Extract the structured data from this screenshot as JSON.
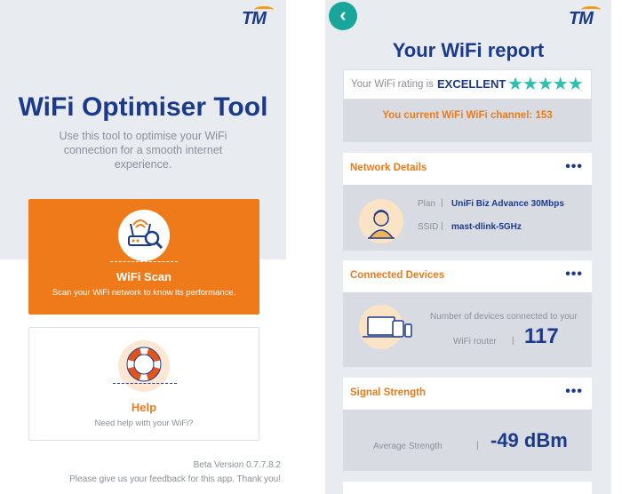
{
  "left_screen": {
    "brand": "TM",
    "title": "WiFi Optimiser Tool",
    "subtitle": "Use this tool to optimise your WiFi connection for a smooth internet experience.",
    "scan_card": {
      "title": "WiFi Scan",
      "description": "Scan your WiFi network to know its performance.",
      "icon": "router-search-icon",
      "color": "#ef7a1a"
    },
    "help_card": {
      "title": "Help",
      "description": "Need help with your WiFi?",
      "icon": "lifebuoy-icon"
    },
    "version": "Beta Version 0.7.7.8.2",
    "feedback": "Please give us your feedback for this app. Thank you!"
  },
  "right_screen": {
    "brand": "TM",
    "back_icon": "chevron-left-icon",
    "title": "Your WiFi report",
    "rating": {
      "label": "Your WiFi rating is",
      "value": "EXCELLENT",
      "stars": "★★★★★",
      "star_count": 5,
      "star_color": "#2dbfb0"
    },
    "channel_text": "You current WiFi WiFi channel: 153",
    "network_details": {
      "heading": "Network Details",
      "menu": "•••",
      "plan_label": "Plan",
      "plan_value": "UniFi Biz Advance 30Mbps",
      "ssid_label": "SSID",
      "ssid_value": "mast-dlink-5GHz",
      "separator": "|",
      "icon": "user-avatar-icon"
    },
    "connected_devices": {
      "heading": "Connected Devices",
      "menu": "•••",
      "label": "Number of devices connected to your",
      "router_label": "WiFi router",
      "separator": "|",
      "count": "117",
      "icon": "devices-icon"
    },
    "signal_strength": {
      "heading": "Signal Strength",
      "menu": "•••",
      "label": "Average Strength",
      "separator": "|",
      "value": "-49 dBm"
    }
  },
  "colors": {
    "brand_blue": "#1b3a8c",
    "accent_orange": "#ef7a1a",
    "teal": "#18a59a",
    "background_grey": "#e8ecf1"
  }
}
